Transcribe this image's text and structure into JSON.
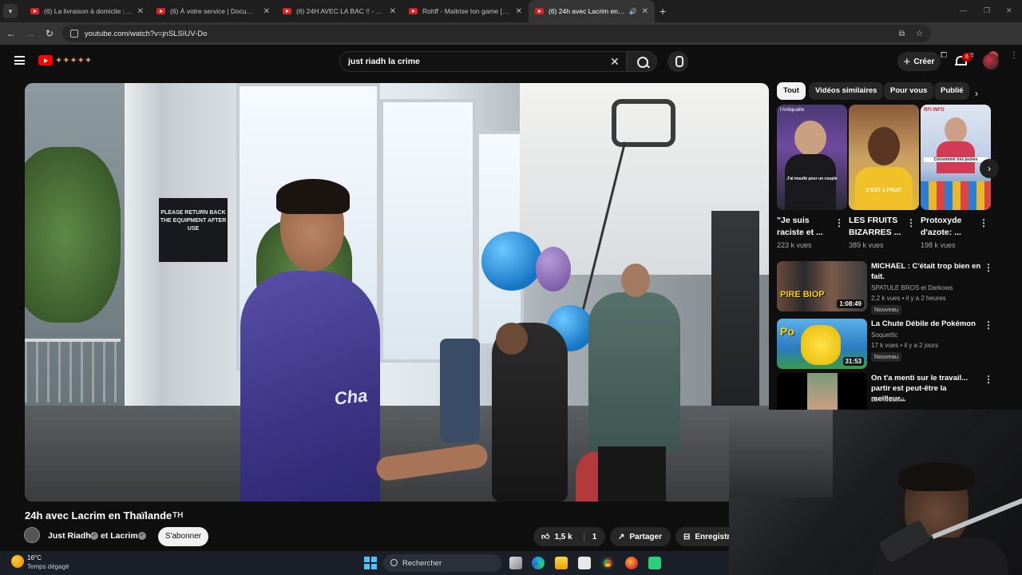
{
  "browser": {
    "tabs": [
      {
        "title": "(6) La livraison à domicile : de l'"
      },
      {
        "title": "(6) À votre service | Documenta"
      },
      {
        "title": "(6) 24H AVEC LA BAC !! - YouTu"
      },
      {
        "title": "Rohff - Maitrise ton game [Clip"
      },
      {
        "title": "(6) 24h avec Lacrim en Thaïla"
      }
    ],
    "url": "youtube.com/watch?v=jnSLSIUV-Do"
  },
  "header": {
    "search_query": "just riadh la crime",
    "create_label": "Créer",
    "notif_count": "6"
  },
  "video": {
    "sign_text": "PLEASE RETURN BACK THE EQUIPMENT AFTER USE",
    "title": "24h avec Lacrim en Thaïlande",
    "title_suffix": "TH",
    "channel_a": "Just Riadh",
    "channel_and": "et Lacrim",
    "subscribe_label": "S'abonner",
    "likes": "1,5 k",
    "dislikes": "1",
    "share_label": "Partager",
    "save_label": "Enregistre"
  },
  "chips": [
    "Tout",
    "Vidéos similaires",
    "Pour vous",
    "Publié"
  ],
  "shorts": [
    {
      "title": "\"Je suis raciste et ...",
      "views": "223 k vues",
      "caption": "J'ai insulté pour un couple",
      "top": "l'Antiquaille"
    },
    {
      "title": "LES FRUITS BIZARRES ...",
      "views": "389 k vues",
      "caption": "C'EST 1 FRUIT",
      "top": ""
    },
    {
      "title": "Protoxyde d'azote: ...",
      "views": "198 k vues",
      "caption": "Consommé très jeunes",
      "top": "RFI INFO"
    }
  ],
  "related": [
    {
      "title": "MICHAEL : C'était trop bien en fait.",
      "channel": "SPATULE BROS et Darkows",
      "meta": "2,2 k vues • il y a 2 heures",
      "badge": "Nouveau",
      "duration": "1:08:49",
      "overlay": "PIRE BIOP"
    },
    {
      "title": "La Chute Débile de Pokémon",
      "channel": "Soquettic",
      "meta": "17 k vues • il y a 2 jours",
      "badge": "Nouveau",
      "duration": "31:53",
      "overlay": ""
    },
    {
      "title": "On t'a menti sur le travail... partir est peut-être la meilleur...",
      "channel": "Le Résilient",
      "meta": "",
      "badge": "",
      "duration": "",
      "overlay": ""
    }
  ],
  "taskbar": {
    "temp": "16°C",
    "weather": "Temps dégagé",
    "search_label": "Rechercher"
  }
}
